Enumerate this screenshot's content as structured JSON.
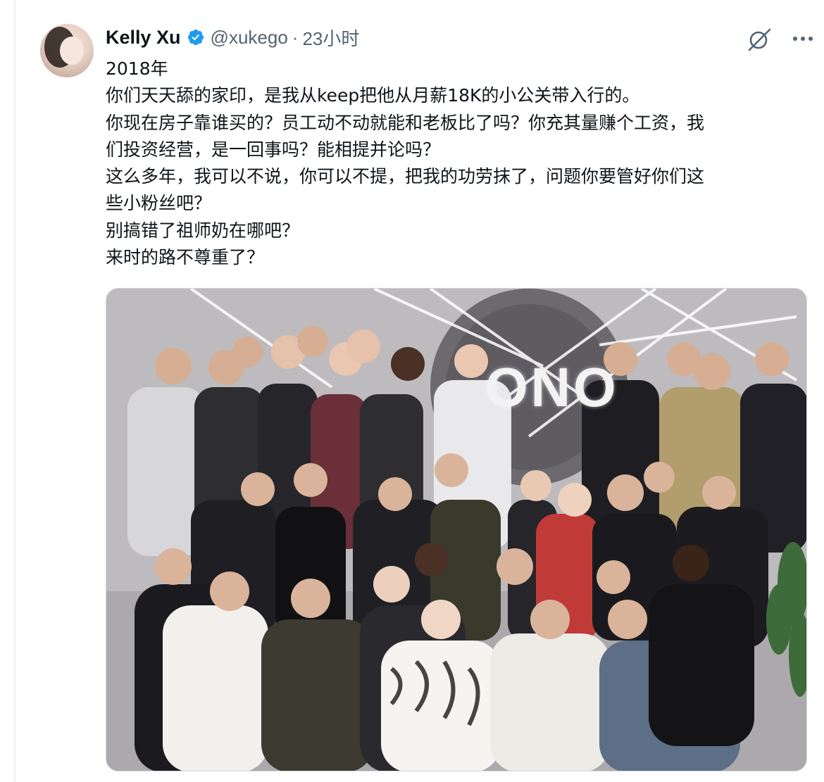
{
  "author": {
    "name": "Kelly Xu",
    "handle": "@xukego",
    "separator": "·",
    "time": "23小时",
    "verified_icon": "verified-badge-icon",
    "verified_color": "#1d9bf0"
  },
  "actions": {
    "grok_icon": "grok-icon",
    "more_icon": "more-options-icon"
  },
  "tweet_lines": [
    "2018年",
    "你们天天舔的家印，是我从keep把他从月薪18K的小公关带入行的。",
    "你现在房子靠谁买的？员工动不动就能和老板比了吗？你充其量赚个工资，我",
    "们投资经营，是一回事吗？能相提并论吗？",
    "这么多年，我可以不说，你可以不提，把我的功劳抹了，问题你要管好你们这",
    "些小粉丝吧？",
    "别搞错了祖师奶在哪吧？",
    "来时的路不尊重了？"
  ],
  "photo": {
    "logo_text": "ONO"
  },
  "colors": {
    "text_primary": "#0f1419",
    "text_secondary": "#536471",
    "border": "#cfd9de"
  }
}
